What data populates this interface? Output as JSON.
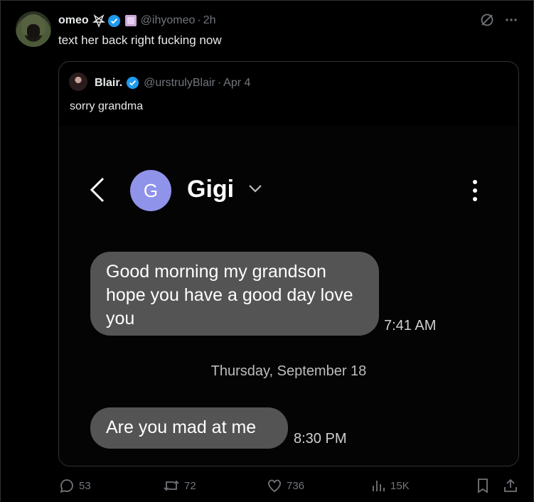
{
  "post": {
    "author_name": "omeo",
    "handle": "@ihyomeo",
    "time": "2h",
    "text": "text her back right fucking now"
  },
  "quoted": {
    "author_name": "Blair.",
    "handle": "@urstrulyBlair",
    "time": "Apr 4",
    "text": "sorry grandma"
  },
  "screenshot": {
    "contact_initial": "G",
    "contact_name": "Gigi",
    "message1": "Good morning my grandson hope you have a good day love you",
    "message1_time": "7:41 AM",
    "date_divider": "Thursday, September 18",
    "message2": "Are you mad at me",
    "message2_time": "8:30 PM"
  },
  "actions": {
    "replies": "53",
    "reposts": "72",
    "likes": "736",
    "views": "15K"
  },
  "colors": {
    "background": "#000000",
    "text": "#e7e9ea",
    "muted": "#71767b",
    "verified": "#1d9bf0",
    "bubble": "#545454",
    "contact_avatar": "#8f93ea"
  },
  "icons": [
    "pentagram-icon",
    "verified-badge-icon",
    "affiliate-badge-icon",
    "grok-icon",
    "more-icon",
    "back-arrow-icon",
    "chevron-down-icon",
    "kebab-menu-icon",
    "reply-icon",
    "repost-icon",
    "like-icon",
    "views-icon",
    "bookmark-icon",
    "share-icon"
  ]
}
